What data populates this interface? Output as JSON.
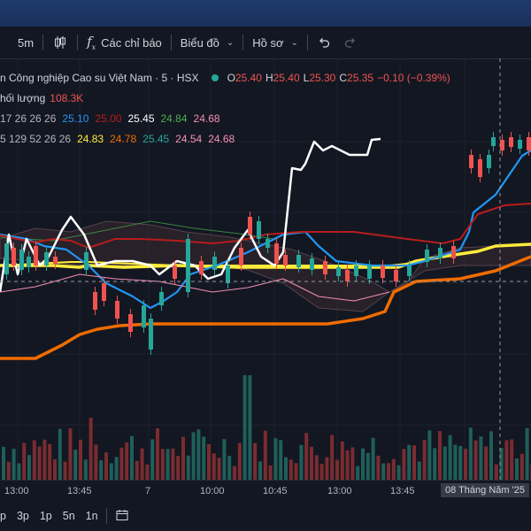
{
  "toolbar": {
    "interval": "5m",
    "indicators_label": "Các chỉ báo",
    "chart_label": "Biểu đồ",
    "profile_label": "Hồ sơ"
  },
  "legend": {
    "symbol_title": "n Công nghiệp Cao su Việt Nam · 5 · HSX",
    "o_label": "O",
    "o": "25.40",
    "h_label": "H",
    "h": "25.40",
    "l_label": "L",
    "l": "25.30",
    "c_label": "C",
    "c": "25.35",
    "change": "−0.10 (−0.39%)",
    "volume_label": "hối lượng",
    "volume_value": "108.3K",
    "ind1_params": "17 26 26 26",
    "ind1_values": [
      "25.10",
      "25.00",
      "25.45",
      "24.84",
      "24.68"
    ],
    "ind2_params": "5 129 52 26 26",
    "ind2_values": [
      "24.83",
      "24.78",
      "25.45",
      "24.54",
      "24.68"
    ]
  },
  "time_axis": {
    "ticks": [
      "13:00",
      "13:45",
      "7",
      "10:00",
      "10:45",
      "13:00",
      "13:45"
    ],
    "crosshair_label": "08 Tháng Năm '25"
  },
  "bottom_bar": {
    "ranges": [
      "p",
      "3p",
      "1p",
      "5n",
      "1n"
    ]
  },
  "colors": {
    "up": "#26a69a",
    "down": "#ef5350",
    "blue": "#2196f3",
    "red_line": "#b71c1c",
    "yellow": "#ffeb3b",
    "orange": "#ef6c00",
    "green_line": "#4caf50",
    "pink": "#f48fb1",
    "white": "#ffffff"
  }
}
